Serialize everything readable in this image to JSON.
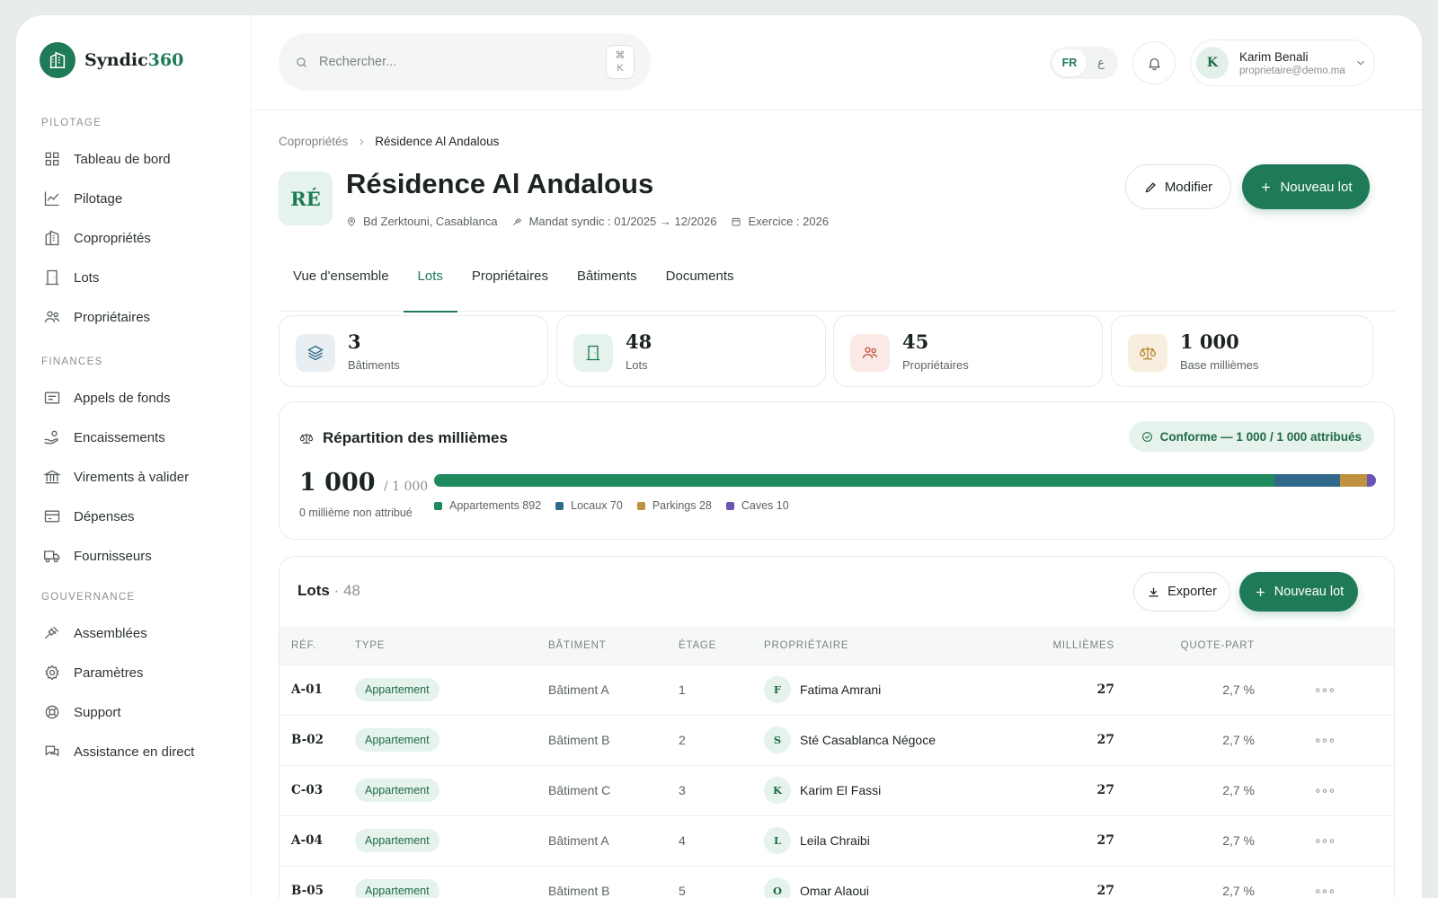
{
  "brand": {
    "name_part1": "Syndic",
    "name_part2": "360"
  },
  "sidebar": {
    "sections": [
      "PILOTAGE",
      "FINANCES",
      "GOUVERNANCE"
    ],
    "items": [
      {
        "label": "Tableau de bord",
        "icon": "grid-icon"
      },
      {
        "label": "Pilotage",
        "icon": "chart-line-icon"
      },
      {
        "label": "Copropriétés",
        "icon": "building-icon"
      },
      {
        "label": "Lots",
        "icon": "door-icon"
      },
      {
        "label": "Propriétaires",
        "icon": "users-icon"
      },
      {
        "label": "Appels de fonds",
        "icon": "receipt-icon"
      },
      {
        "label": "Encaissements",
        "icon": "hand-coins-icon"
      },
      {
        "label": "Virements à valider",
        "icon": "bank-icon"
      },
      {
        "label": "Dépenses",
        "icon": "card-icon"
      },
      {
        "label": "Fournisseurs",
        "icon": "truck-icon"
      },
      {
        "label": "Assemblées",
        "icon": "gavel-icon"
      },
      {
        "label": "Paramètres",
        "icon": "gear-icon"
      },
      {
        "label": "Support",
        "icon": "lifebuoy-icon"
      },
      {
        "label": "Assistance en direct",
        "icon": "chat-icon"
      }
    ]
  },
  "topbar": {
    "search_placeholder": "Rechercher...",
    "kbd_symbol": "⌘",
    "kbd_key": "K",
    "lang_fr": "FR",
    "lang_ar": "ع",
    "user_initial": "K",
    "user_name": "Karim Benali",
    "user_email": "proprietaire@demo.ma"
  },
  "breadcrumb": {
    "parent": "Copropriétés",
    "current": "Résidence Al Andalous"
  },
  "header": {
    "badge": "RÉ",
    "title": "Résidence Al Andalous",
    "address": "Bd Zerktouni, Casablanca",
    "mandat": "Mandat syndic : 01/2025 → 12/2026",
    "exercice": "Exercice : 2026",
    "edit_label": "Modifier",
    "new_lot_label": "Nouveau lot"
  },
  "tabs": [
    "Vue d'ensemble",
    "Lots",
    "Propriétaires",
    "Bâtiments",
    "Documents"
  ],
  "active_tab": "Lots",
  "stats": [
    {
      "value": "3",
      "label": "Bâtiments"
    },
    {
      "value": "48",
      "label": "Lots"
    },
    {
      "value": "45",
      "label": "Propriétaires"
    },
    {
      "value": "1 000",
      "label": "Base millièmes"
    }
  ],
  "repartition": {
    "title": "Répartition des millièmes",
    "status": "Conforme — 1 000 / 1 000 attribués",
    "total": "1 000",
    "total_base": "/ 1 000",
    "unassigned": "0 millième non attribué",
    "segments": [
      {
        "label": "Appartements 892",
        "value": 892,
        "color": "#1f8a5e"
      },
      {
        "label": "Locaux 70",
        "value": 70,
        "color": "#2f6a8a"
      },
      {
        "label": "Parkings 28",
        "value": 28,
        "color": "#c0913f"
      },
      {
        "label": "Caves 10",
        "value": 10,
        "color": "#6b55b3"
      }
    ]
  },
  "lots": {
    "title": "Lots",
    "count": "· 48",
    "export_label": "Exporter",
    "new_lot_label": "Nouveau lot",
    "columns": [
      "RÉF.",
      "TYPE",
      "BÂTIMENT",
      "ÉTAGE",
      "PROPRIÉTAIRE",
      "MILLIÈMES",
      "QUOTE-PART"
    ],
    "rows": [
      {
        "ref": "A-01",
        "type": "Appartement",
        "batiment": "Bâtiment A",
        "etage": "1",
        "initial": "F",
        "owner": "Fatima Amrani",
        "milliemes": "27",
        "quote": "2,7 %"
      },
      {
        "ref": "B-02",
        "type": "Appartement",
        "batiment": "Bâtiment B",
        "etage": "2",
        "initial": "S",
        "owner": "Sté Casablanca Négoce",
        "milliemes": "27",
        "quote": "2,7 %"
      },
      {
        "ref": "C-03",
        "type": "Appartement",
        "batiment": "Bâtiment C",
        "etage": "3",
        "initial": "K",
        "owner": "Karim El Fassi",
        "milliemes": "27",
        "quote": "2,7 %"
      },
      {
        "ref": "A-04",
        "type": "Appartement",
        "batiment": "Bâtiment A",
        "etage": "4",
        "initial": "L",
        "owner": "Leila Chraibi",
        "milliemes": "27",
        "quote": "2,7 %"
      },
      {
        "ref": "B-05",
        "type": "Appartement",
        "batiment": "Bâtiment B",
        "etage": "5",
        "initial": "O",
        "owner": "Omar Alaoui",
        "milliemes": "27",
        "quote": "2,7 %"
      }
    ]
  }
}
